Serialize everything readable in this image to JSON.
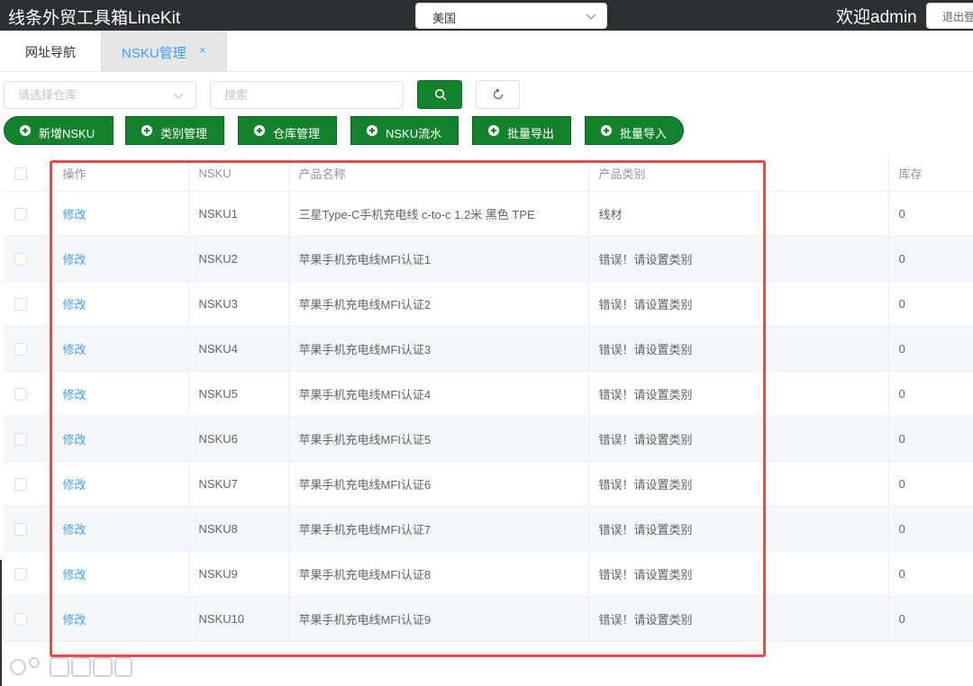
{
  "header": {
    "app_title": "线条外贸工具箱LineKit",
    "country_selected": "美国",
    "welcome": "欢迎admin",
    "logout_label": "退出登录"
  },
  "tabs": [
    {
      "label": "网址导航",
      "active": false
    },
    {
      "label": "NSKU管理",
      "active": true,
      "closable": true
    }
  ],
  "filters": {
    "warehouse_placeholder": "请选择仓库",
    "search_placeholder": "搜索"
  },
  "actions": [
    {
      "label": "新增NSKU"
    },
    {
      "label": "类别管理"
    },
    {
      "label": "仓库管理"
    },
    {
      "label": "NSKU流水"
    },
    {
      "label": "批量导出"
    },
    {
      "label": "批量导入"
    }
  ],
  "table": {
    "columns": [
      "操作",
      "NSKU",
      "产品名称",
      "产品类别",
      "库存"
    ],
    "rows": [
      {
        "action": "修改",
        "nsku": "NSKU1",
        "name": "三星Type-C手机充电线 c-to-c 1.2米 黑色 TPE",
        "category": "线材",
        "stock": "0"
      },
      {
        "action": "修改",
        "nsku": "NSKU2",
        "name": "苹果手机充电线MFI认证1",
        "category": "错误！请设置类别",
        "stock": "0"
      },
      {
        "action": "修改",
        "nsku": "NSKU3",
        "name": "苹果手机充电线MFI认证2",
        "category": "错误！请设置类别",
        "stock": "0"
      },
      {
        "action": "修改",
        "nsku": "NSKU4",
        "name": "苹果手机充电线MFI认证3",
        "category": "错误！请设置类别",
        "stock": "0"
      },
      {
        "action": "修改",
        "nsku": "NSKU5",
        "name": "苹果手机充电线MFI认证4",
        "category": "错误！请设置类别",
        "stock": "0"
      },
      {
        "action": "修改",
        "nsku": "NSKU6",
        "name": "苹果手机充电线MFI认证5",
        "category": "错误！请设置类别",
        "stock": "0"
      },
      {
        "action": "修改",
        "nsku": "NSKU7",
        "name": "苹果手机充电线MFI认证6",
        "category": "错误！请设置类别",
        "stock": "0"
      },
      {
        "action": "修改",
        "nsku": "NSKU8",
        "name": "苹果手机充电线MFI认证7",
        "category": "错误！请设置类别",
        "stock": "0"
      },
      {
        "action": "修改",
        "nsku": "NSKU9",
        "name": "苹果手机充电线MFI认证8",
        "category": "错误！请设置类别",
        "stock": "0"
      },
      {
        "action": "修改",
        "nsku": "NSKU10",
        "name": "苹果手机充电线MFI认证9",
        "category": "错误！请设置类别",
        "stock": "0"
      }
    ]
  },
  "colors": {
    "header_bg": "#2e2f31",
    "primary_green": "#14822c",
    "link_blue": "#409eff",
    "highlight_red": "#e5484d"
  },
  "icons": [
    "chevron-down-icon",
    "search-icon",
    "refresh-icon",
    "plus-circle-icon",
    "close-icon",
    "watermark-logo"
  ]
}
